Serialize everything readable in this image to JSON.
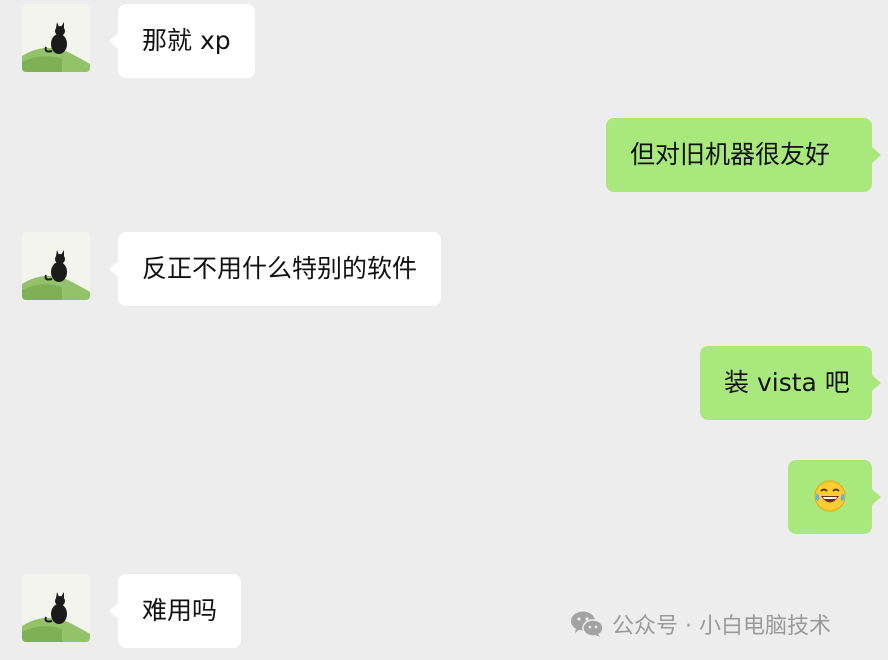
{
  "messages": [
    {
      "side": "in",
      "text": "那就 xp"
    },
    {
      "side": "out",
      "text": "但对旧机器很友好"
    },
    {
      "side": "in",
      "text": "反正不用什么特别的软件"
    },
    {
      "side": "out",
      "text": "装 vista 吧"
    },
    {
      "side": "out",
      "emoji": "laughing-with-tears"
    },
    {
      "side": "in",
      "text": "难用吗"
    }
  ],
  "watermark": {
    "text": "公众号 · 小白电脑技术",
    "icon": "wechat-icon"
  },
  "colors": {
    "background": "#ededed",
    "incoming_bubble": "#ffffff",
    "outgoing_bubble": "#a9e87c",
    "watermark": "#9a9a9a"
  }
}
